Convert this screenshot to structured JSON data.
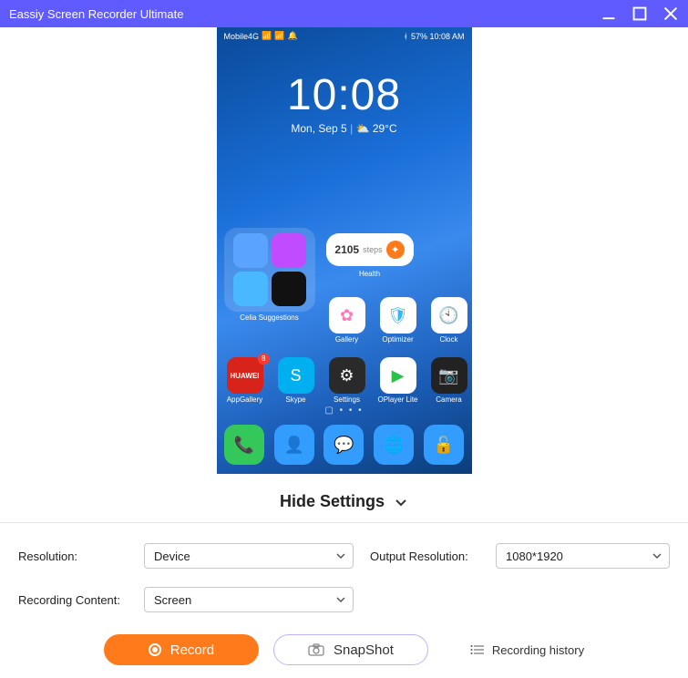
{
  "titlebar": {
    "text": "Eassiy Screen Recorder Ultimate"
  },
  "phone": {
    "status_left": "Mobile4G",
    "status_right": "57%  10:08 AM",
    "bt_icon": "ᚼ",
    "time": "10:08",
    "date": "Mon, Sep 5",
    "weather": "29°C",
    "health_steps": "2105",
    "health_unit": "steps",
    "health_label": "Health",
    "suggestions_label": "Celia Suggestions",
    "apps": {
      "gallery": "Gallery",
      "optimizer": "Optimizer",
      "clock": "Clock",
      "appgallery": "AppGallery",
      "skype": "Skype",
      "settings": "Settings",
      "oplayer": "OPlayer Lite",
      "camera": "Camera",
      "appgallery_badge": "8"
    }
  },
  "hide_settings_label": "Hide Settings",
  "settings": {
    "resolution_label": "Resolution:",
    "resolution_value": "Device",
    "output_resolution_label": "Output Resolution:",
    "output_resolution_value": "1080*1920",
    "recording_content_label": "Recording Content:",
    "recording_content_value": "Screen"
  },
  "buttons": {
    "record": "Record",
    "snapshot": "SnapShot",
    "history": "Recording history"
  }
}
